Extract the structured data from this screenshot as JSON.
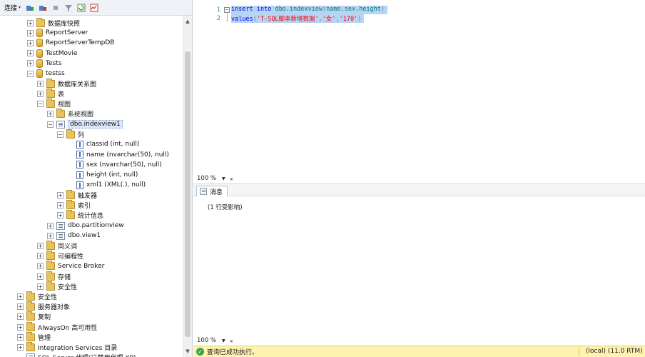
{
  "explorer": {
    "toolbar": {
      "connect_label": "连接",
      "connect_arrow": "▾"
    },
    "tree": [
      {
        "label": "数据库快照",
        "icon": "folder-icon",
        "exp": "+"
      },
      {
        "label": "ReportServer",
        "icon": "database-icon",
        "exp": "+"
      },
      {
        "label": "ReportServerTempDB",
        "icon": "database-icon",
        "exp": "+"
      },
      {
        "label": "TestMovie",
        "icon": "database-icon",
        "exp": "+"
      },
      {
        "label": "Tests",
        "icon": "database-icon",
        "exp": "+"
      },
      {
        "label": "testss",
        "icon": "database-icon",
        "exp": "−"
      },
      {
        "label": "数据库关系图",
        "icon": "folder-icon",
        "exp": "+"
      },
      {
        "label": "表",
        "icon": "folder-icon",
        "exp": "+"
      },
      {
        "label": "视图",
        "icon": "folder-icon",
        "exp": "−"
      },
      {
        "label": "系统视图",
        "icon": "folder-icon",
        "exp": "+"
      },
      {
        "label": "dbo.indexview1",
        "icon": "view-icon",
        "exp": "−"
      },
      {
        "label": "列",
        "icon": "folder-icon",
        "exp": "−"
      },
      {
        "label": "classid (int, null)",
        "icon": "column-icon",
        "exp": ""
      },
      {
        "label": "name (nvarchar(50), null)",
        "icon": "column-icon",
        "exp": ""
      },
      {
        "label": "sex (nvarchar(50), null)",
        "icon": "column-icon",
        "exp": ""
      },
      {
        "label": "height (int, null)",
        "icon": "column-icon",
        "exp": ""
      },
      {
        "label": "xml1 (XML(.), null)",
        "icon": "column-icon",
        "exp": ""
      },
      {
        "label": "触发器",
        "icon": "folder-icon",
        "exp": "+"
      },
      {
        "label": "索引",
        "icon": "folder-icon",
        "exp": "+"
      },
      {
        "label": "统计信息",
        "icon": "folder-icon",
        "exp": "+"
      },
      {
        "label": "dbo.partitionview",
        "icon": "view-icon",
        "exp": "+"
      },
      {
        "label": "dbo.view1",
        "icon": "view-icon",
        "exp": "+"
      },
      {
        "label": "同义词",
        "icon": "folder-icon",
        "exp": "+"
      },
      {
        "label": "可编程性",
        "icon": "folder-icon",
        "exp": "+"
      },
      {
        "label": "Service Broker",
        "icon": "folder-icon",
        "exp": "+"
      },
      {
        "label": "存储",
        "icon": "folder-icon",
        "exp": "+"
      },
      {
        "label": "安全性",
        "icon": "folder-icon",
        "exp": "+"
      },
      {
        "label": "安全性",
        "icon": "folder-icon",
        "exp": "+"
      },
      {
        "label": "服务器对象",
        "icon": "folder-icon",
        "exp": "+"
      },
      {
        "label": "复制",
        "icon": "folder-icon",
        "exp": "+"
      },
      {
        "label": "AlwaysOn 高可用性",
        "icon": "folder-icon",
        "exp": "+"
      },
      {
        "label": "管理",
        "icon": "folder-icon",
        "exp": "+"
      },
      {
        "label": "Integration Services 目录",
        "icon": "folder-icon",
        "exp": "+"
      },
      {
        "label": "SQL Server 代理(已禁用代理 XP)",
        "icon": "agent-icon",
        "exp": ""
      }
    ]
  },
  "editor": {
    "lines": [
      {
        "num": "1",
        "parts": [
          {
            "t": "insert",
            "c": "kw"
          },
          {
            "t": " ",
            "c": "plain"
          },
          {
            "t": "into",
            "c": "kw"
          },
          {
            "t": " dbo.indexview",
            "c": "obj"
          },
          {
            "t": "(",
            "c": "gray"
          },
          {
            "t": "name",
            "c": "obj"
          },
          {
            "t": ",",
            "c": "gray"
          },
          {
            "t": "sex",
            "c": "obj"
          },
          {
            "t": ",",
            "c": "gray"
          },
          {
            "t": "height",
            "c": "obj"
          },
          {
            "t": ")",
            "c": "gray"
          }
        ]
      },
      {
        "num": "2",
        "parts": [
          {
            "t": "values",
            "c": "kw"
          },
          {
            "t": "(",
            "c": "gray"
          },
          {
            "t": "'T-SQL脚本新增数据'",
            "c": "str"
          },
          {
            "t": ",",
            "c": "gray"
          },
          {
            "t": "'女'",
            "c": "str"
          },
          {
            "t": ",",
            "c": "gray"
          },
          {
            "t": "'170'",
            "c": "str"
          },
          {
            "t": ")",
            "c": "gray"
          }
        ]
      }
    ],
    "collapse_glyph": "−",
    "zoom": "100 %"
  },
  "results": {
    "tab_label": "消息",
    "message": "(1 行受影响)",
    "zoom": "100 %"
  },
  "status": {
    "text": "查询已成功执行。",
    "server": "(local) (11.0 RTM)",
    "bar_color": "#fff1b0"
  }
}
